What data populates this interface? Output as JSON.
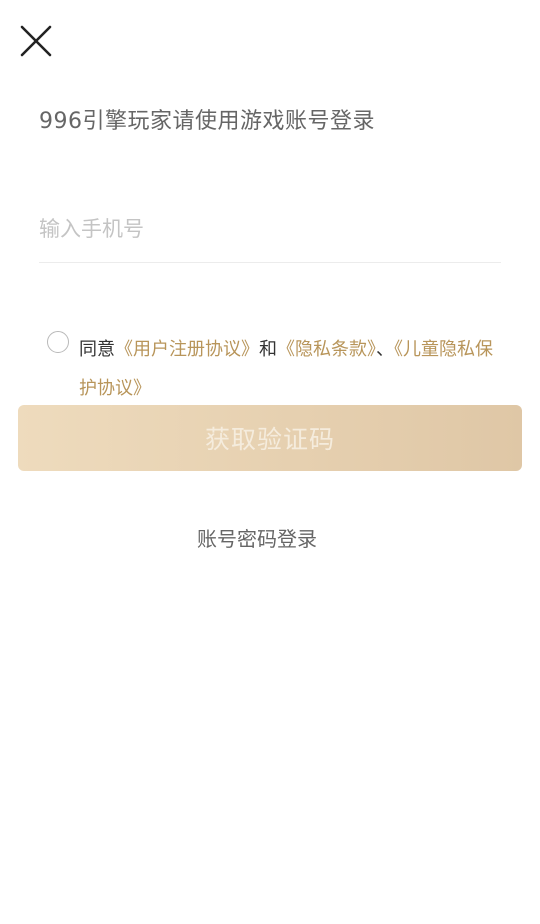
{
  "header": {
    "close_icon": "close-icon"
  },
  "subtitle": "996引擎玩家请使用游戏账号登录",
  "phone": {
    "value": "",
    "placeholder": "输入手机号"
  },
  "agreement": {
    "prefix": "同意",
    "user_agreement": "《用户注册协议》",
    "and": "和",
    "privacy_terms": "《隐私条款》",
    "separator": "、",
    "child_privacy": "《儿童隐私保护协议》",
    "checked": false
  },
  "get_code_button": "获取验证码",
  "password_login_link": "账号密码登录",
  "colors": {
    "link": "#b8955a",
    "button_gradient_start": "#eedbbd",
    "button_gradient_end": "#dfc7a6",
    "button_text": "#f5ecdd"
  }
}
